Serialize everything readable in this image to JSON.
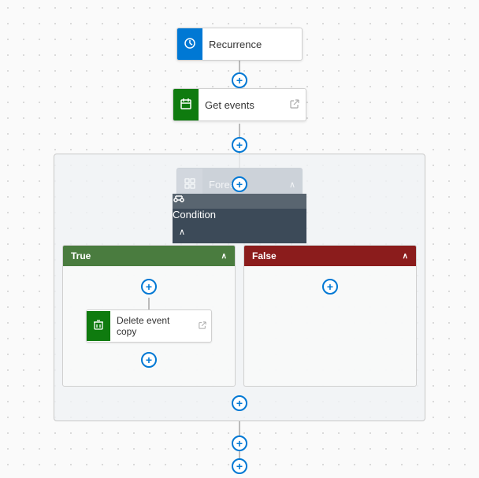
{
  "canvas": {
    "background": "#fafafa"
  },
  "steps": {
    "recurrence": {
      "label": "Recurrence",
      "icon": "⏱",
      "iconBg": "#0078d4"
    },
    "getEvents": {
      "label": "Get events",
      "icon": "📅",
      "iconBg": "#0f7b0f",
      "hasLink": true
    },
    "foreach": {
      "label": "Foreach",
      "icon": "↻",
      "iconBg": "#3d4f6b"
    },
    "condition": {
      "label": "Condition",
      "icon": "⊞",
      "iconBg": "#3c4a58"
    },
    "deleteEventCopy": {
      "label": "Delete event copy",
      "icon": "🗑",
      "iconBg": "#0f7b0f",
      "hasLink": true
    }
  },
  "branches": {
    "true": {
      "label": "True",
      "color": "#4a7c3f"
    },
    "false": {
      "label": "False",
      "color": "#8b1c1c"
    }
  },
  "plusButton": {
    "symbol": "+"
  }
}
